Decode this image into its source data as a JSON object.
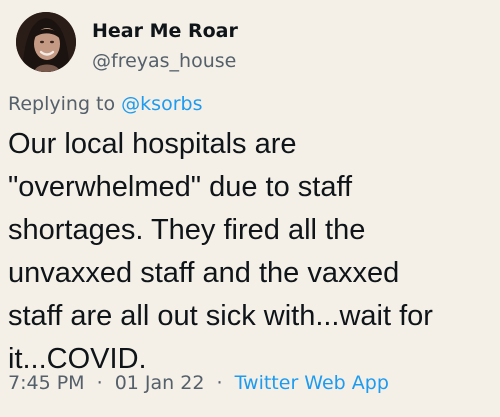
{
  "author": {
    "display_name": "Hear Me Roar",
    "handle": "@freyas_house",
    "avatar": "profile-photo"
  },
  "reply": {
    "prefix": "Replying to",
    "mention": "@ksorbs"
  },
  "tweet": {
    "lines": [
      "Our local hospitals are",
      "\"overwhelmed\" due to staff",
      "shortages. They fired all the",
      "unvaxxed staff and the vaxxed",
      "staff are all out sick with...wait for",
      "it...COVID."
    ]
  },
  "meta": {
    "time": "7:45 PM",
    "date": "01 Jan 22",
    "separator": "·",
    "source": "Twitter Web App"
  },
  "colors": {
    "background": "#f4f0e7",
    "text": "#0f1419",
    "secondary": "#55606b",
    "link": "#1d9bf0"
  }
}
